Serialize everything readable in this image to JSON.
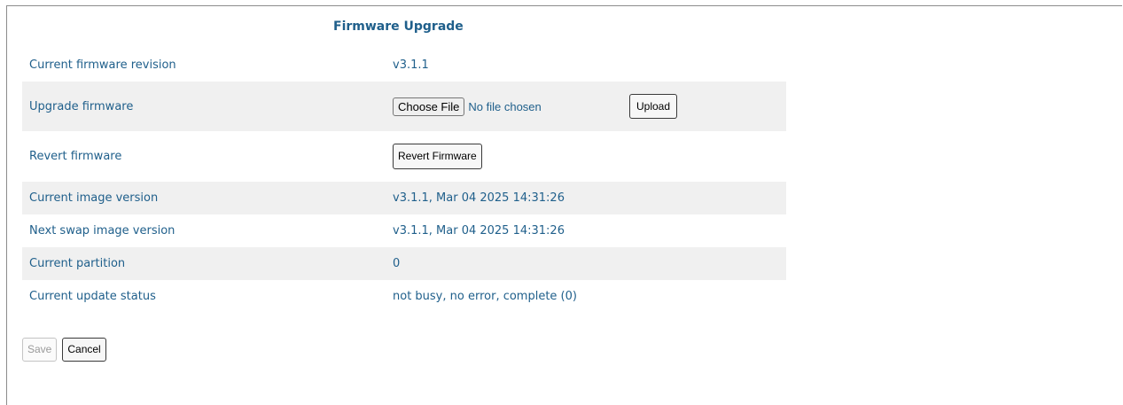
{
  "page": {
    "title": "Firmware Upgrade"
  },
  "rows": {
    "current_firmware_revision": {
      "label": "Current firmware revision",
      "value": "v3.1.1"
    },
    "upgrade_firmware": {
      "label": "Upgrade firmware",
      "choose_file_label": "Choose File",
      "file_status": "No file chosen",
      "upload_label": "Upload"
    },
    "revert_firmware": {
      "label": "Revert firmware",
      "button_label": "Revert Firmware"
    },
    "current_image_version": {
      "label": "Current image version",
      "value": "v3.1.1, Mar 04 2025 14:31:26"
    },
    "next_swap_image_version": {
      "label": "Next swap image version",
      "value": "v3.1.1, Mar 04 2025 14:31:26"
    },
    "current_partition": {
      "label": "Current partition",
      "value": "0"
    },
    "current_update_status": {
      "label": "Current update status",
      "value": "not busy, no error, complete (0)"
    }
  },
  "footer": {
    "save_label": "Save",
    "cancel_label": "Cancel"
  },
  "colors": {
    "text": "#1f5f8b",
    "row_shade": "#f0f0f0",
    "frame_border": "#8c8c8c"
  }
}
